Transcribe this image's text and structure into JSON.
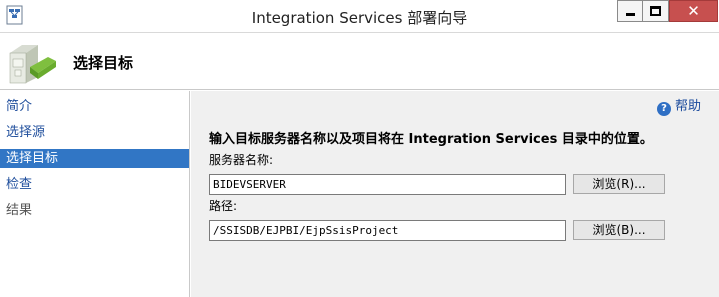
{
  "window": {
    "title": "Integration Services 部署向导",
    "close_glyph": "✕"
  },
  "header": {
    "title": "选择目标"
  },
  "sidebar": {
    "items": [
      {
        "label": "简介",
        "state": "link"
      },
      {
        "label": "选择源",
        "state": "link"
      },
      {
        "label": "选择目标",
        "state": "selected"
      },
      {
        "label": "检查",
        "state": "link"
      },
      {
        "label": "结果",
        "state": "disabled"
      }
    ]
  },
  "main": {
    "help_label": "帮助",
    "help_icon_glyph": "?",
    "instruction": "输入目标服务器名称以及项目将在 Integration Services 目录中的位置。",
    "server_label": "服务器名称:",
    "server_value": "BIDEVSERVER",
    "server_browse_label": "浏览(R)...",
    "path_label": "路径:",
    "path_value": "/SSISDB/EJPBI/EjpSsisProject",
    "path_browse_label": "浏览(B)..."
  },
  "colors": {
    "selected_bg": "#3176c5",
    "link": "#1f4e9c",
    "close_button": "#c7504f",
    "content_bg": "#f0f0f0"
  }
}
